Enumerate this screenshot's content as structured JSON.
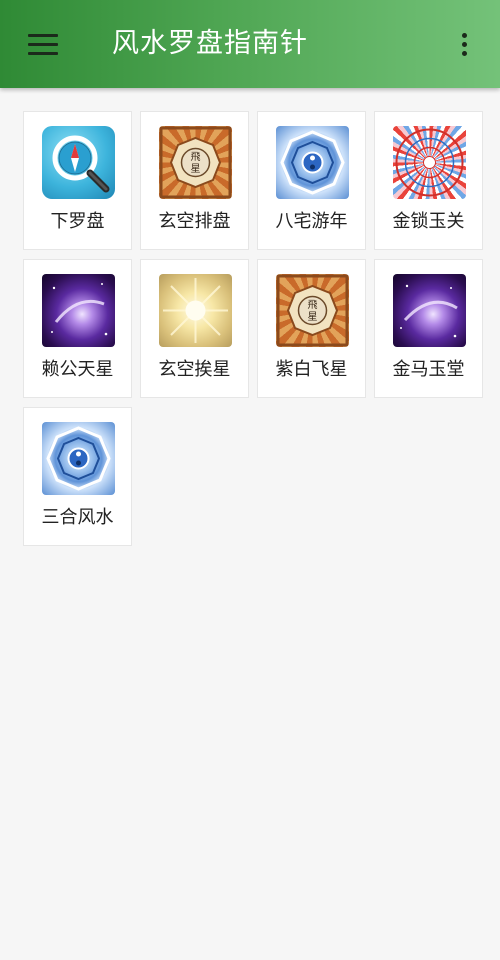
{
  "appbar": {
    "title": "风水罗盘指南针",
    "menu_icon": "hamburger-menu-icon",
    "more_icon": "more-vertical-icon",
    "colors": {
      "start": "#2f8a35",
      "end": "#74c279"
    }
  },
  "tiles": [
    {
      "label": "下罗盘",
      "icon": "compass-magnifier-icon"
    },
    {
      "label": "玄空排盘",
      "icon": "flying-star-chart-icon"
    },
    {
      "label": "八宅游年",
      "icon": "bagua-diagram-icon"
    },
    {
      "label": "金锁玉关",
      "icon": "luopan-wheel-icon"
    },
    {
      "label": "赖公天星",
      "icon": "purple-galaxy-icon"
    },
    {
      "label": "玄空挨星",
      "icon": "golden-glow-icon"
    },
    {
      "label": "紫白飞星",
      "icon": "flying-star-chart-icon"
    },
    {
      "label": "金马玉堂",
      "icon": "purple-galaxy-icon"
    },
    {
      "label": "三合风水",
      "icon": "bagua-diagram-icon"
    }
  ]
}
